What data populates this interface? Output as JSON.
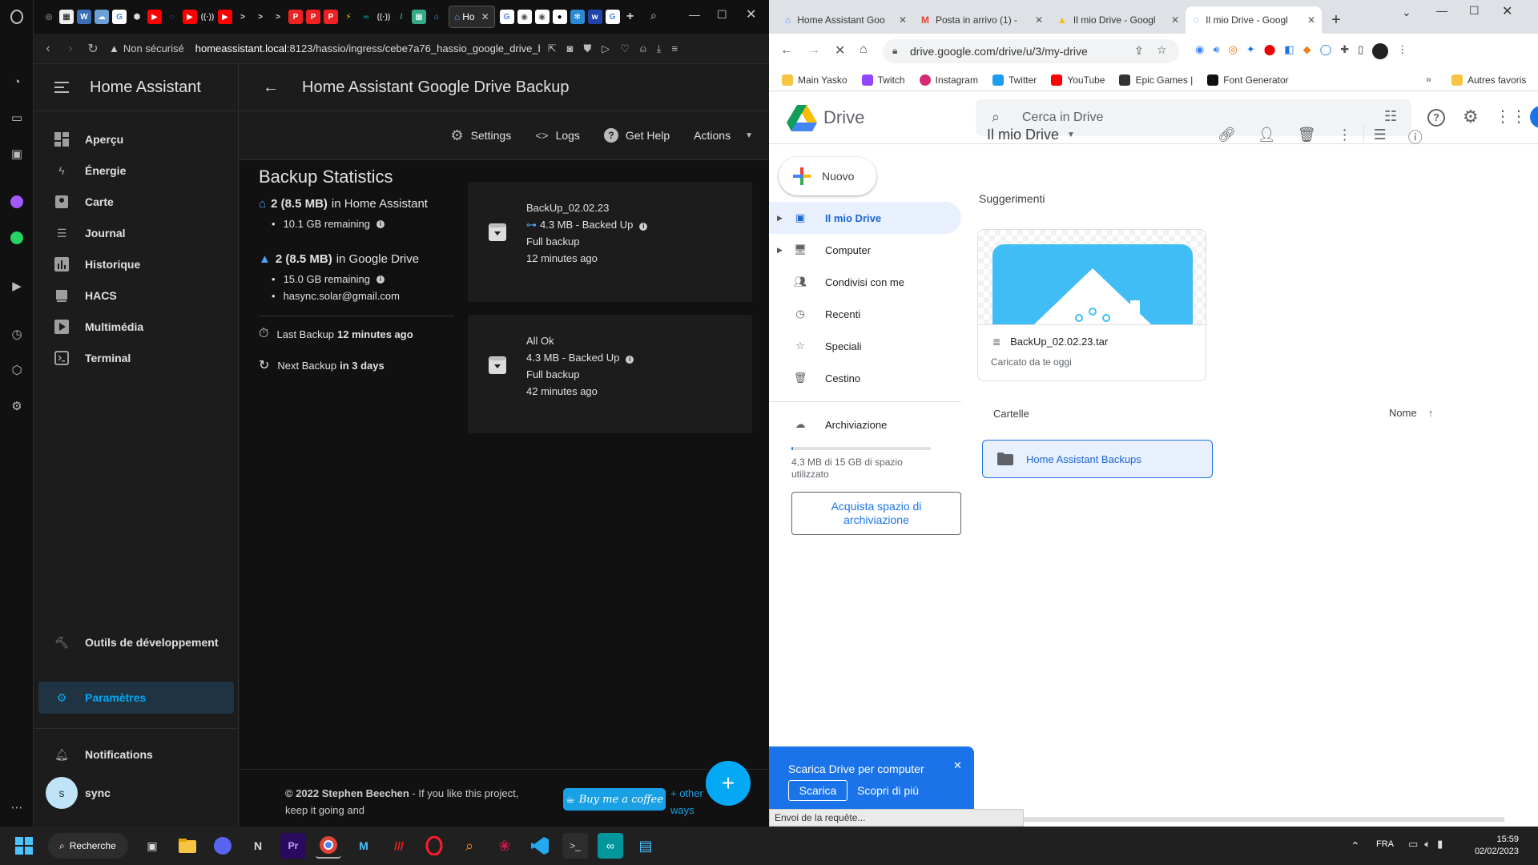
{
  "opera": {
    "tab_title": "Ho",
    "not_secure": "Non sécurisé",
    "url_host": "homeassistant.local",
    "url_rest": ":8123/hassio/ingress/cebe7a76_hassio_google_drive_ba"
  },
  "ha": {
    "app_title": "Home Assistant",
    "nav": [
      {
        "label": "Aperçu",
        "icon": "dashboard-icon"
      },
      {
        "label": "Énergie",
        "icon": "lightning-icon"
      },
      {
        "label": "Carte",
        "icon": "map-icon"
      },
      {
        "label": "Journal",
        "icon": "list-icon"
      },
      {
        "label": "Historique",
        "icon": "chart-icon"
      },
      {
        "label": "HACS",
        "icon": "hacs-icon"
      },
      {
        "label": "Multimédia",
        "icon": "media-icon"
      },
      {
        "label": "Terminal",
        "icon": "terminal-icon"
      }
    ],
    "dev_tools": "Outils de développement",
    "settings": "Paramètres",
    "notifications": "Notifications",
    "user_initial": "s",
    "user_name": "sync",
    "page_title": "Home Assistant Google Drive Backup",
    "toolbar": {
      "settings": "Settings",
      "logs": "Logs",
      "help": "Get Help",
      "actions": "Actions"
    },
    "stats": {
      "title": "Backup Statistics",
      "ha_count": "2 (8.5 MB)",
      "ha_suffix": "in Home Assistant",
      "ha_remaining": "10.1 GB remaining",
      "gd_count": "2 (8.5 MB)",
      "gd_suffix": "in Google Drive",
      "gd_remaining": "15.0 GB remaining",
      "gd_email": "hasync.solar@gmail.com",
      "last_label": "Last Backup",
      "last_value": "12 minutes ago",
      "next_label": "Next Backup",
      "next_value": "in 3 days"
    },
    "backups": [
      {
        "name": "BackUp_02.02.23",
        "size": "4.3 MB - Backed Up",
        "type": "Full backup",
        "age": "12 minutes ago"
      },
      {
        "name": "All Ok",
        "size": "4.3 MB - Backed Up",
        "type": "Full backup",
        "age": "42 minutes ago"
      }
    ],
    "footer": {
      "copyright": "© 2022 Stephen Beechen",
      "text1": " - If you like this project,",
      "text2": "keep it going and",
      "coffee": "Buy me a coffee",
      "other1": "+ other",
      "other2": "ways"
    }
  },
  "chrome": {
    "tabs": [
      {
        "title": "Home Assistant Goo",
        "color": "#4285f4"
      },
      {
        "title": "Posta in arrivo (1) -",
        "color": "#ea4335"
      },
      {
        "title": "Il mio Drive - Googl",
        "color": "#fbbc04"
      },
      {
        "title": "Il mio Drive - Googl",
        "color": "#34a853"
      }
    ],
    "url": "drive.google.com/drive/u/3/my-drive",
    "bookmarks": [
      "Main Yasko",
      "Twitch",
      "Instagram",
      "Twitter",
      "YouTube",
      "Epic Games |",
      "Font Generator"
    ],
    "other_bookmarks": "Autres favoris"
  },
  "drive": {
    "logo": "Drive",
    "search_placeholder": "Cerca in Drive",
    "new_button": "Nuovo",
    "nav": [
      {
        "label": "Il mio Drive",
        "icon": "my-drive-icon"
      },
      {
        "label": "Computer",
        "icon": "computer-icon"
      },
      {
        "label": "Condivisi con me",
        "icon": "shared-icon"
      },
      {
        "label": "Recenti",
        "icon": "clock-icon"
      },
      {
        "label": "Speciali",
        "icon": "star-icon"
      },
      {
        "label": "Cestino",
        "icon": "trash-icon"
      }
    ],
    "storage_label": "Archiviazione",
    "storage_used": "4,3 MB di 15 GB di spazio utilizzato",
    "storage_fill": 0.003,
    "buy_storage": "Acquista spazio di archiviazione",
    "breadcrumb": "Il mio Drive",
    "suggestions": "Suggerimenti",
    "file_name": "BackUp_02.02.23.tar",
    "file_sub": "Caricato da te oggi",
    "folders_label": "Cartelle",
    "sort_label": "Nome",
    "folder_name": "Home Assistant Backups",
    "banner_title": "Scarica Drive per computer",
    "banner_download": "Scarica",
    "banner_more": "Scopri di più",
    "status": "Envoi de la requête..."
  },
  "taskbar": {
    "search": "Recherche",
    "lang": "FRA",
    "time": "15:59",
    "date": "02/02/2023"
  }
}
